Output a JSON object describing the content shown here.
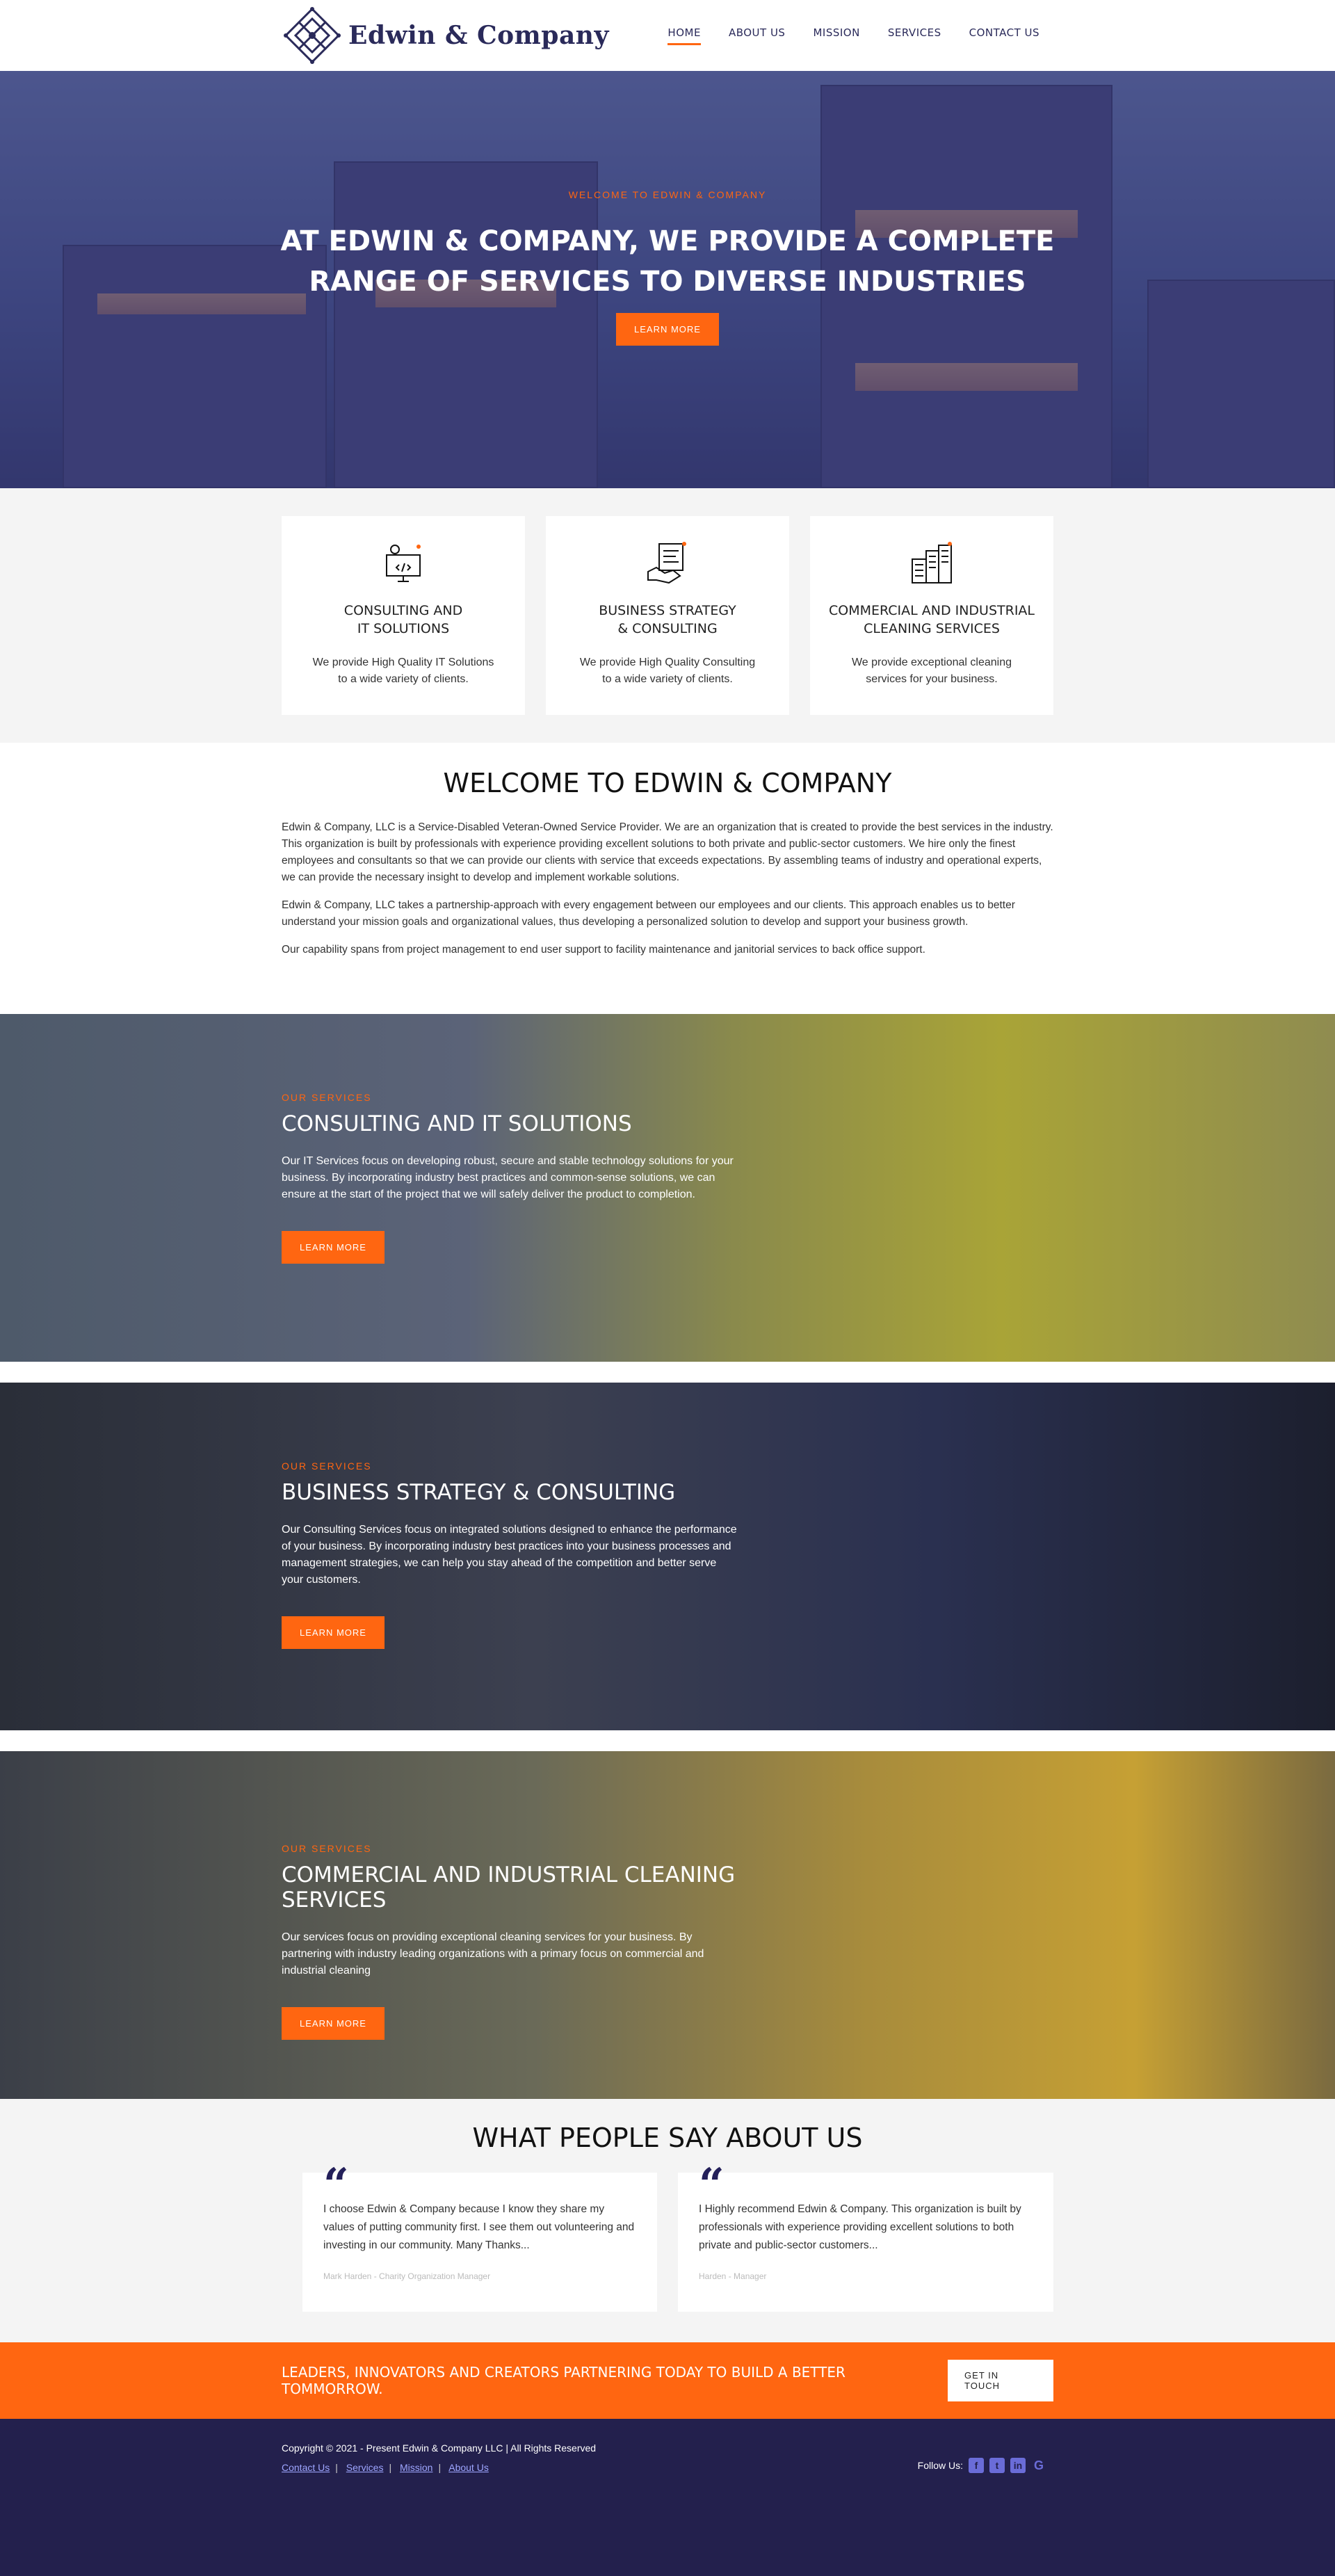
{
  "brand": {
    "name": "Edwin & Company"
  },
  "nav": {
    "items": [
      {
        "label": "HOME",
        "active": true
      },
      {
        "label": "ABOUT US",
        "active": false
      },
      {
        "label": "MISSION",
        "active": false
      },
      {
        "label": "SERVICES",
        "active": false
      },
      {
        "label": "CONTACT US",
        "active": false
      }
    ]
  },
  "hero": {
    "eyebrow": "WELCOME TO EDWIN & COMPANY",
    "title_line1": "AT EDWIN & COMPANY, WE PROVIDE A COMPLETE",
    "title_line2": "RANGE OF SERVICES TO DIVERSE INDUSTRIES",
    "button": "LEARN MORE"
  },
  "cards": [
    {
      "icon": "it-solutions-icon",
      "title": "CONSULTING AND\nIT SOLUTIONS",
      "text": "We provide High Quality IT Solutions to a wide variety of clients."
    },
    {
      "icon": "strategy-handshake-icon",
      "title": "BUSINESS STRATEGY\n& CONSULTING",
      "text": "We provide High Quality Consulting to a wide variety of clients."
    },
    {
      "icon": "buildings-icon",
      "title": "COMMERCIAL AND INDUSTRIAL\nCLEANING SERVICES",
      "text": "We provide exceptional cleaning services for your business."
    }
  ],
  "welcome": {
    "title": "WELCOME TO EDWIN & COMPANY",
    "p1": "Edwin & Company, LLC is a Service-Disabled Veteran-Owned Service Provider. We are an organization that is created to provide the best services in the industry. This organization is built by professionals with experience providing excellent solutions to both private and public-sector customers. We hire only the finest employees and consultants so that we can provide our clients with service that exceeds expectations. By assembling teams of industry and operational experts, we can provide the necessary insight to develop and implement workable solutions.",
    "p2": "Edwin & Company, LLC takes a partnership-approach with every engagement between our employees and our clients. This approach enables us to better understand your mission goals and organizational values, thus developing a personalized solution to develop and support your business growth.",
    "p3": "Our capability spans from project management to end user support to facility maintenance and janitorial services to back office support."
  },
  "bands": [
    {
      "eyebrow": "OUR SERVICES",
      "title": "CONSULTING AND IT SOLUTIONS",
      "text": "Our IT Services focus on developing robust, secure and stable technology solutions for your business. By incorporating industry best practices and common-sense solutions, we can ensure at the start of the project that we will safely deliver the product to completion.",
      "button": "LEARN MORE"
    },
    {
      "eyebrow": "OUR SERVICES",
      "title": "BUSINESS STRATEGY & CONSULTING",
      "text": "Our Consulting Services focus on integrated solutions designed to enhance the performance of your business. By incorporating industry best practices into your business processes and management strategies, we can help you stay ahead of the competition and better serve your customers.",
      "button": "LEARN MORE"
    },
    {
      "eyebrow": "OUR SERVICES",
      "title": "COMMERCIAL AND INDUSTRIAL CLEANING SERVICES",
      "text": "Our services focus on providing exceptional cleaning services for your business. By partnering with industry leading organizations with a primary focus on commercial and industrial cleaning",
      "button": "LEARN MORE"
    }
  ],
  "testimonials": {
    "title": "WHAT PEOPLE SAY ABOUT US",
    "items": [
      {
        "text": "I choose Edwin & Company because I know they share my values of putting community first. I see them out volunteering and investing in our community. Many Thanks...",
        "who": "Mark Harden - Charity Organization Manager"
      },
      {
        "text": "I Highly recommend Edwin & Company. This organization is built by professionals with experience providing excellent solutions to both private and public-sector customers...",
        "who": "Harden - Manager"
      }
    ]
  },
  "cta": {
    "text": "LEADERS, INNOVATORS AND CREATORS PARTNERING TODAY TO BUILD A BETTER TOMMORROW.",
    "button": "GET IN TOUCH"
  },
  "footer": {
    "copyright": "Copyright © 2021 - Present Edwin & Company LLC | All Rights Reserved",
    "links": [
      "Contact Us",
      "Services",
      "Mission",
      "About Us"
    ],
    "follow": "Follow Us:",
    "social": [
      "facebook-icon",
      "twitter-icon",
      "linkedin-icon",
      "google-icon"
    ]
  },
  "colors": {
    "accent": "#ff6611",
    "navy": "#23204d"
  }
}
